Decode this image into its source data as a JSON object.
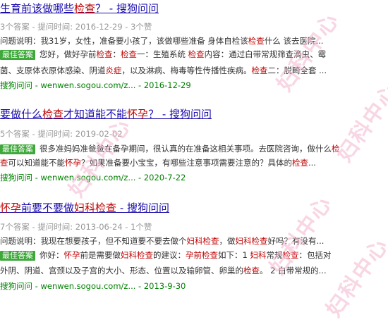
{
  "watermark": "妇科中心",
  "results": [
    {
      "title_parts": [
        {
          "text": "生育前该做哪些",
          "hl": false
        },
        {
          "text": "检查",
          "hl": true
        },
        {
          "text": "？ - 搜狗问问",
          "hl": false
        }
      ],
      "meta": "3个答案 - 提问时间: 2016-12-29 - 3个赞",
      "question_label": "问题说明：",
      "question_parts": [
        {
          "text": "我31岁，女性，准备要小孩了，该做哪些准备 身体自检该",
          "hl": false
        },
        {
          "text": "检查",
          "hl": true
        },
        {
          "text": "什么 该去医院...",
          "hl": false
        }
      ],
      "badge": "最佳答案",
      "answer_line1_parts": [
        {
          "text": "您好，做好孕前",
          "hl": false
        },
        {
          "text": "检查",
          "hl": true
        },
        {
          "text": "：",
          "hl": false
        },
        {
          "text": "检查",
          "hl": true
        },
        {
          "text": "一：生殖系统 ",
          "hl": false
        },
        {
          "text": "检查",
          "hl": true
        },
        {
          "text": "内容：通过白带常规筛查滴虫、霉",
          "hl": false
        }
      ],
      "answer_line2_parts": [
        {
          "text": "菌、支原体衣原体感染、阴道",
          "hl": false
        },
        {
          "text": "炎症",
          "hl": true
        },
        {
          "text": "，以及淋病、梅毒等性传播性疾病。",
          "hl": false
        },
        {
          "text": "检查",
          "hl": true
        },
        {
          "text": "二：脱畸全套 ...",
          "hl": false
        }
      ],
      "source": "搜狗问问 - wenwen.sogou.com/z... - 2016-12-29"
    },
    {
      "title_parts": [
        {
          "text": "要做什么",
          "hl": false
        },
        {
          "text": "检查",
          "hl": true
        },
        {
          "text": "才知道能不能",
          "hl": false
        },
        {
          "text": "怀孕",
          "hl": true
        },
        {
          "text": "？ - 搜狗问问",
          "hl": false
        }
      ],
      "meta": "5个答案 - 提问时间: 2019-02-02",
      "badge": "最佳答案",
      "answer_line1_parts": [
        {
          "text": "很多准妈妈准爸爸在备孕期间，很认真的在准备这相关事项。去医院咨询，做什么",
          "hl": false
        },
        {
          "text": "检",
          "hl": true
        }
      ],
      "answer_line2_parts": [
        {
          "text": "查",
          "hl": true
        },
        {
          "text": "可以知道能不能",
          "hl": false
        },
        {
          "text": "怀孕",
          "hl": true
        },
        {
          "text": "？如果准备要小宝宝，有哪些注意事项需要注意的？具体的",
          "hl": false
        },
        {
          "text": "检查",
          "hl": true
        },
        {
          "text": "...",
          "hl": false
        }
      ],
      "source": "搜狗问问 - wenwen.sogou.com/z... - 2020-7-22"
    },
    {
      "title_parts": [
        {
          "text": "怀孕",
          "hl": true
        },
        {
          "text": "前要不要做",
          "hl": false
        },
        {
          "text": "妇科检查",
          "hl": true
        },
        {
          "text": " - 搜狗问问",
          "hl": false
        }
      ],
      "meta": "7个答案 - 提问时间: 2013-06-24 - 1个赞",
      "question_label": "问题说明：",
      "question_parts": [
        {
          "text": "我现在想要孩子，但不知道要不要去做个",
          "hl": false
        },
        {
          "text": "妇科检查",
          "hl": true
        },
        {
          "text": "，做",
          "hl": false
        },
        {
          "text": "妇科检查",
          "hl": true
        },
        {
          "text": "好吗？有没有...",
          "hl": false
        }
      ],
      "badge": "最佳答案",
      "answer_line1_parts": [
        {
          "text": "你好：",
          "hl": false
        },
        {
          "text": "怀孕",
          "hl": true
        },
        {
          "text": "前是需要做",
          "hl": false
        },
        {
          "text": "妇科检查",
          "hl": true
        },
        {
          "text": "的建议：",
          "hl": false
        },
        {
          "text": "孕前检查",
          "hl": true
        },
        {
          "text": "如下：1 ",
          "hl": false
        },
        {
          "text": "妇科",
          "hl": true
        },
        {
          "text": "常规",
          "hl": false
        },
        {
          "text": "检查",
          "hl": true
        },
        {
          "text": "：包括对",
          "hl": false
        }
      ],
      "answer_line2_parts": [
        {
          "text": "外阴、阴道、宫颈以及子宫的大小、形态、位置以及输卵管、卵巢的",
          "hl": false
        },
        {
          "text": "检查",
          "hl": true
        },
        {
          "text": "。 2 白带常规的...",
          "hl": false
        }
      ],
      "source": "搜狗问问 - wenwen.sogou.com/z... - 2013-9-30"
    }
  ]
}
